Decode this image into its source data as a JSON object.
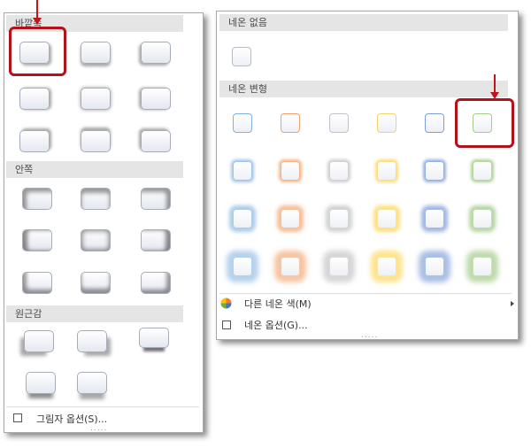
{
  "left_panel": {
    "sections": {
      "outer": "바깥쪽",
      "inner": "안쪽",
      "perspective": "원근감"
    },
    "footer_option": "그림자 옵션(S)...",
    "grip": "....."
  },
  "right_panel": {
    "sections": {
      "no_glow": "네온 없음",
      "variations": "네온 변형"
    },
    "more_colors": "다른 네온 색(M)",
    "glow_options": "네온 옵션(G)...",
    "grip": "....."
  },
  "glow_colors": [
    "#5b9bd5",
    "#ed7d31",
    "#a5a5a5",
    "#ffc000",
    "#4472c4",
    "#70ad47"
  ]
}
